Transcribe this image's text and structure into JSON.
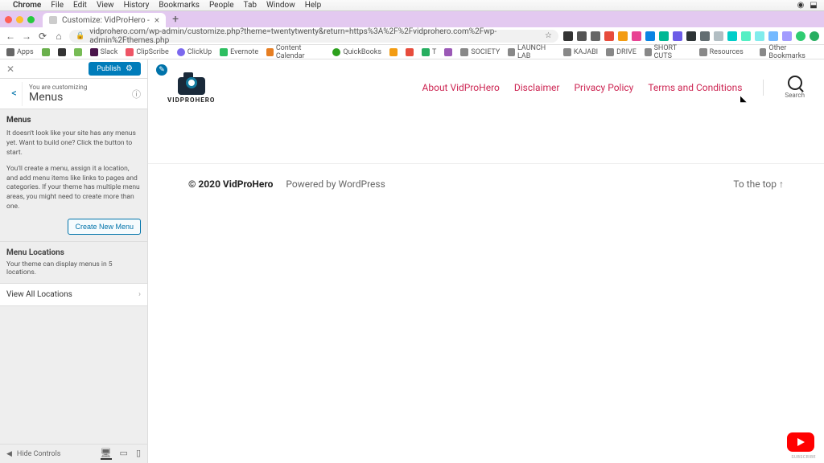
{
  "mac_menu": {
    "active_app": "Chrome",
    "items": [
      "File",
      "Edit",
      "View",
      "History",
      "Bookmarks",
      "People",
      "Tab",
      "Window",
      "Help"
    ]
  },
  "browser": {
    "tab_title": "Customize: VidProHero -",
    "url": "vidprohero.com/wp-admin/customize.php?theme=twentytwenty&return=https%3A%2F%2Fvidprohero.com%2Fwp-admin%2Fthemes.php",
    "bookmarks": [
      {
        "label": "Apps",
        "c": "#666"
      },
      {
        "label": "",
        "c": "#6ab04c"
      },
      {
        "label": "",
        "c": "#333"
      },
      {
        "label": "",
        "c": "#7b5"
      },
      {
        "label": "Slack",
        "c": "#4a154b"
      },
      {
        "label": "ClipScribe",
        "c": "#e56"
      },
      {
        "label": "ClickUp",
        "c": "#7b68ee"
      },
      {
        "label": "Evernote",
        "c": "#2dbe60"
      },
      {
        "label": "Content Calendar",
        "c": "#e67e22"
      },
      {
        "label": "QuickBooks",
        "c": "#2ca01c"
      },
      {
        "label": "",
        "c": "#f39c12"
      },
      {
        "label": "",
        "c": "#e74c3c"
      },
      {
        "label": "T",
        "c": "#27ae60"
      },
      {
        "label": "",
        "c": "#9b59b6"
      },
      {
        "label": "SOCIETY",
        "c": "#888"
      },
      {
        "label": "LAUNCH LAB",
        "c": "#888"
      },
      {
        "label": "KAJABI",
        "c": "#888"
      },
      {
        "label": "DRIVE",
        "c": "#888"
      },
      {
        "label": "SHORT CUTS",
        "c": "#888"
      },
      {
        "label": "Resources",
        "c": "#888"
      }
    ],
    "other_bookmarks": "Other Bookmarks"
  },
  "customizer": {
    "publish": "Publish",
    "you_are": "You are customizing",
    "section": "Menus",
    "menus_h": "Menus",
    "menus_p1": "It doesn't look like your site has any menus yet. Want to build one? Click the button to start.",
    "menus_p2": "You'll create a menu, assign it a location, and add menu items like links to pages and categories. If your theme has multiple menu areas, you might need to create more than one.",
    "create": "Create New Menu",
    "loc_h": "Menu Locations",
    "loc_p": "Your theme can display menus in 5 locations.",
    "view_all": "View All Locations",
    "hide": "Hide Controls"
  },
  "preview": {
    "brand": "VIDPROHERO",
    "nav": [
      "About VidProHero",
      "Disclaimer",
      "Privacy Policy",
      "Terms and Conditions"
    ],
    "search": "Search",
    "copy": "© 2020 VidProHero",
    "powered": "Powered by WordPress",
    "totop": "To the top ↑"
  },
  "yt": "SUBSCRIBE"
}
